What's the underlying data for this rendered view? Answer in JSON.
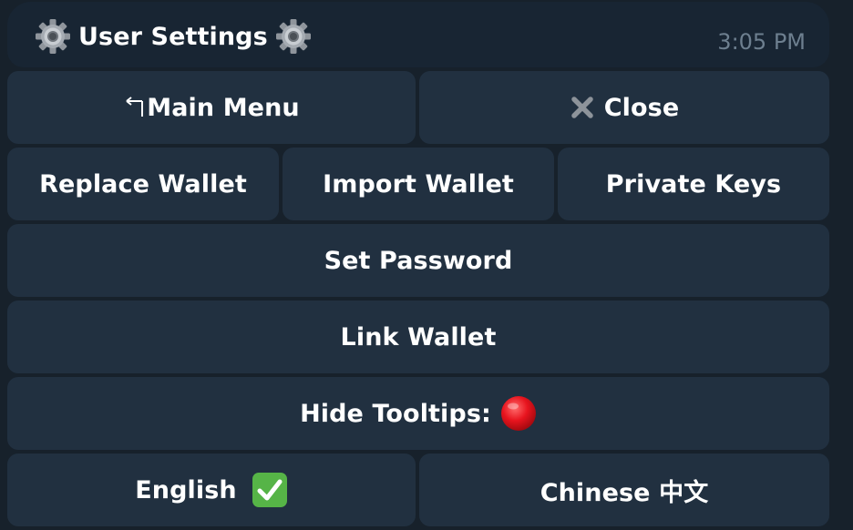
{
  "header": {
    "title": "User Settings",
    "time": "3:05 PM",
    "left_icon": "gear-icon",
    "right_icon": "gear-icon"
  },
  "buttons": {
    "main_menu": {
      "label": "Main Menu",
      "icon": "return-arrow-icon"
    },
    "close": {
      "label": "Close",
      "icon": "close-x-icon"
    },
    "replace_wallet": {
      "label": "Replace Wallet"
    },
    "import_wallet": {
      "label": "Import Wallet"
    },
    "private_keys": {
      "label": "Private Keys"
    },
    "set_password": {
      "label": "Set Password"
    },
    "link_wallet": {
      "label": "Link Wallet"
    },
    "hide_tooltips": {
      "label": "Hide Tooltips:",
      "icon": "red-circle-icon"
    },
    "english": {
      "label": "English",
      "icon": "check-mark-icon"
    },
    "chinese": {
      "label": "Chinese 中文"
    }
  },
  "colors": {
    "background": "#17212b",
    "button": "#213040",
    "text": "#ffffff",
    "time": "#6d7f8f",
    "status_red": "#e8141e",
    "check_green": "#56b447"
  }
}
